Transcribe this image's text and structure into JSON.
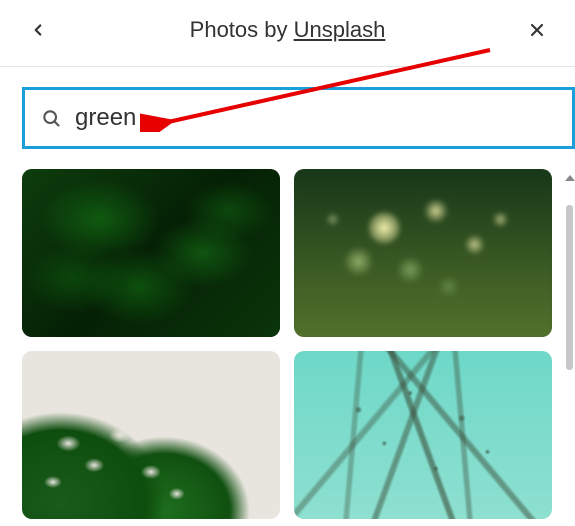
{
  "header": {
    "prefix": "Photos by ",
    "provider": "Unsplash"
  },
  "search": {
    "value": "green"
  },
  "images": [
    {
      "name": "result-ferns"
    },
    {
      "name": "result-bokeh-grass"
    },
    {
      "name": "result-monstera-leaf"
    },
    {
      "name": "result-teal-branches"
    }
  ],
  "colors": {
    "accent": "#1a9fd9",
    "annotation": "#e60000"
  }
}
